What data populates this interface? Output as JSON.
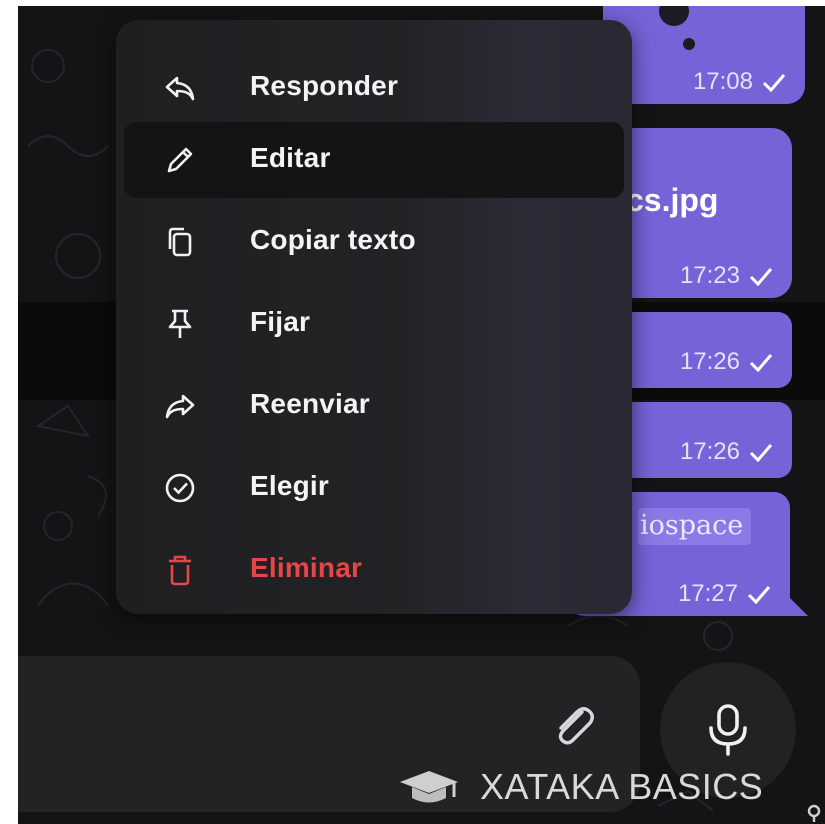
{
  "menu": {
    "items": [
      {
        "label": "Responder",
        "icon": "reply-icon"
      },
      {
        "label": "Editar",
        "icon": "pencil-icon",
        "highlighted": true
      },
      {
        "label": "Copiar texto",
        "icon": "copy-icon"
      },
      {
        "label": "Fijar",
        "icon": "pin-icon"
      },
      {
        "label": "Reenviar",
        "icon": "forward-icon"
      },
      {
        "label": "Elegir",
        "icon": "check-circle-icon"
      },
      {
        "label": "Eliminar",
        "icon": "trash-icon",
        "danger": true
      }
    ]
  },
  "messages": [
    {
      "time": "17:08"
    },
    {
      "text": "cs.jpg",
      "time": "17:23"
    },
    {
      "time": "17:26"
    },
    {
      "time": "17:26"
    },
    {
      "text": "iospace",
      "time": "17:27"
    }
  ],
  "composer": {
    "attach_icon": "paperclip-icon",
    "mic_icon": "microphone-icon"
  },
  "watermark": {
    "text": "XATAKA BASICS",
    "icon": "graduation-cap-icon"
  },
  "colors": {
    "bubble": "#7663d8",
    "menu_bg": "#232326",
    "danger": "#e84546",
    "background": "#141416"
  }
}
